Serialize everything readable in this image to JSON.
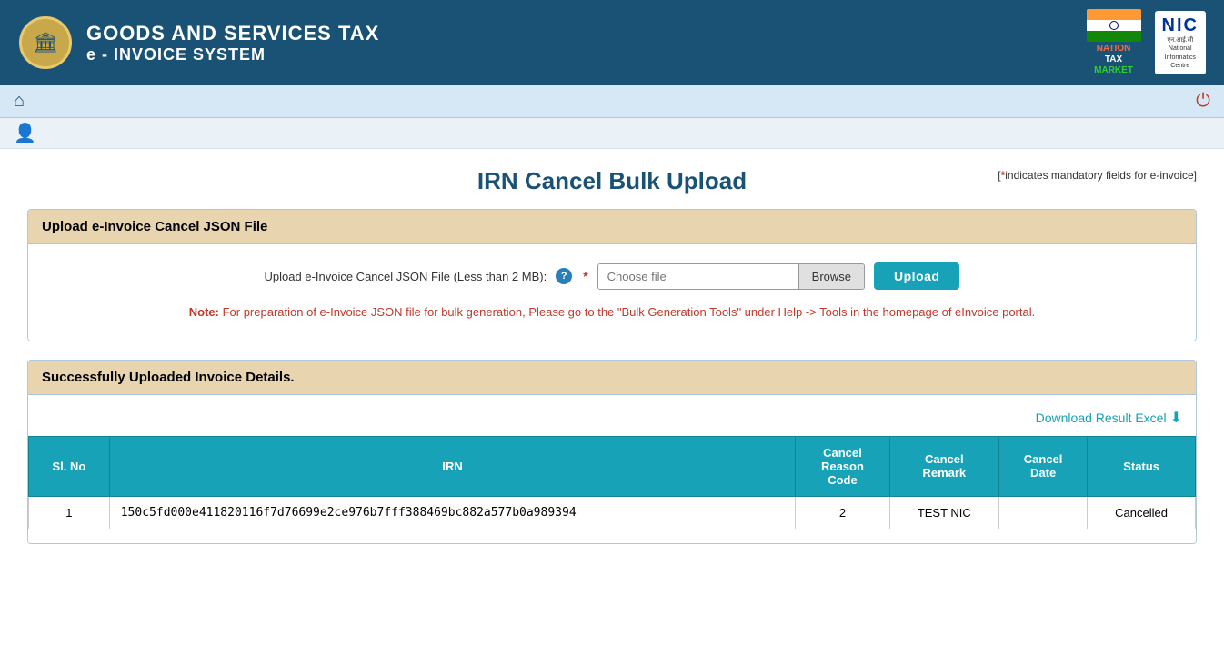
{
  "header": {
    "title_line1": "GOODS AND SERVICES TAX",
    "title_line2": "e - INVOICE SYSTEM",
    "emblem_symbol": "🏛",
    "ntm": {
      "line1": "NATION",
      "line2": "TAX",
      "line3": "MARKET"
    },
    "nic": {
      "title": "NIC",
      "subtitle_line1": "एन.आई.सी",
      "subtitle_line2": "National",
      "subtitle_line3": "Informatics",
      "subtitle_line4": "Centre"
    }
  },
  "nav": {
    "home_icon": "⌂",
    "user_icon": "👤",
    "power_icon": "⏻"
  },
  "page": {
    "title": "IRN Cancel Bulk Upload",
    "mandatory_note": "[*indicates mandatory fields for e-invoice]"
  },
  "upload_section": {
    "header": "Upload e-Invoice Cancel JSON File",
    "label": "Upload e-Invoice Cancel JSON File (Less than 2 MB):",
    "file_placeholder": "Choose file",
    "browse_label": "Browse",
    "upload_label": "Upload",
    "note_label": "Note:",
    "note_text": "For preparation of e-Invoice JSON file for bulk generation, Please go to the \"Bulk Generation Tools\" under Help -> Tools in the homepage of eInvoice portal."
  },
  "result_section": {
    "header": "Successfully Uploaded Invoice Details.",
    "download_label": "Download Result Excel",
    "table": {
      "columns": [
        "Sl. No",
        "IRN",
        "Cancel Reason Code",
        "Cancel Remark",
        "Cancel Date",
        "Status"
      ],
      "rows": [
        {
          "sl_no": "1",
          "irn": "150c5fd000e411820116f7d76699e2ce976b7fff388469bc882a577b0a989394",
          "cancel_reason_code": "2",
          "cancel_remark": "TEST NIC",
          "cancel_date": "",
          "status": "Cancelled"
        }
      ]
    }
  }
}
